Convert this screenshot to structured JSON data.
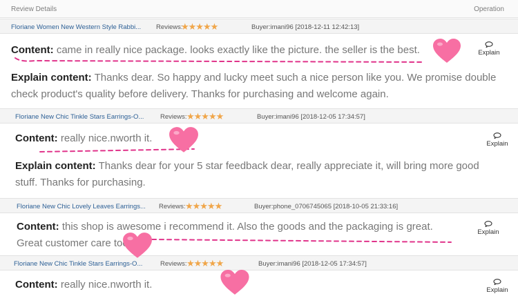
{
  "header": {
    "review_details": "Review Details",
    "operation": "Operation"
  },
  "reviews": [
    {
      "product": "Floriane Women New Western Style Rabbi...",
      "reviews_label": "Reviews:",
      "stars": "★★★★★",
      "buyer": "Buyer:imani96 [2018-12-11 12:42:13]",
      "content_label": "Content:",
      "content": "came in really nice package. looks exactly like the picture. the seller is the best.",
      "explain_label": "Explain content:",
      "explain": "Thanks dear. So happy and lucky meet such a nice person like you. We promise double check product's quality before delivery. Thanks for purchasing and welcome again.",
      "explain_button": "Explain"
    },
    {
      "product": "Floriane New Chic Tinkle Stars Earrings-O...",
      "reviews_label": "Reviews:",
      "stars": "★★★★★",
      "buyer": "Buyer:imani96 [2018-12-05 17:34:57]",
      "content_label": "Content:",
      "content": "really nice.nworth it.",
      "explain_label": "Explain content:",
      "explain": "Thanks dear for your 5 star feedback dear, really appreciate it, will bring more good stuff. Thanks for purchasing.",
      "explain_button": "Explain"
    },
    {
      "product": "Floriane New Chic Lovely Leaves Earrings...",
      "reviews_label": "Reviews:",
      "stars": "★★★★★",
      "buyer": "Buyer:phone_0706745065 [2018-10-05 21:33:16]",
      "content_label": "Content:",
      "content": "this shop is awesome i recommend it. Also the goods and the packaging is great. Great customer care too",
      "explain_button": "Explain"
    },
    {
      "product": "Floriane New Chic Tinkle Stars Earrings-O...",
      "reviews_label": "Reviews:",
      "stars": "★★★★★",
      "buyer": "Buyer:imani96 [2018-12-05 17:34:57]",
      "content_label": "Content:",
      "content": "really nice.nworth it.",
      "explain_button": "Explain"
    }
  ],
  "colors": {
    "heart": "#f76fa3",
    "squiggle": "#e0338a",
    "link": "#2c5f95",
    "star": "#f0a64a"
  }
}
